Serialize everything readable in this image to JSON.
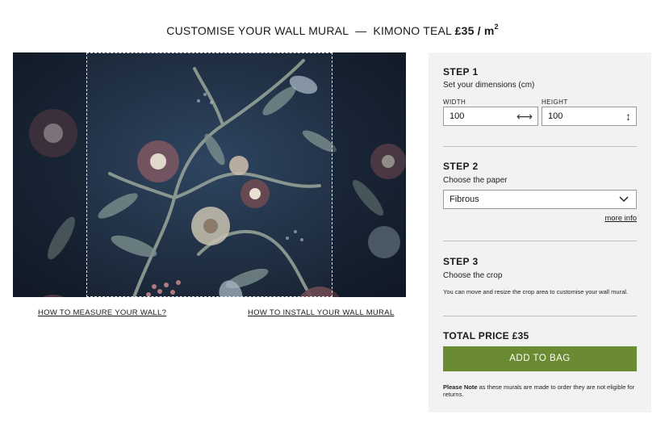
{
  "header": {
    "prefix": "CUSTOMISE YOUR WALL MURAL",
    "separator": "—",
    "product": "KIMONO TEAL",
    "price": "£35 / m",
    "unit_sup": "2"
  },
  "mural": {
    "links": {
      "measure": "HOW TO MEASURE YOUR WALL?",
      "install": "HOW TO INSTALL YOUR WALL MURAL"
    }
  },
  "panel": {
    "step1": {
      "title": "STEP 1",
      "subtitle": "Set your dimensions (cm)",
      "width_label": "WIDTH",
      "width_value": "100",
      "height_label": "HEIGHT",
      "height_value": "100"
    },
    "step2": {
      "title": "STEP 2",
      "subtitle": "Choose the paper",
      "paper_selected": "Fibrous",
      "more_info": "more info"
    },
    "step3": {
      "title": "STEP 3",
      "subtitle": "Choose the crop",
      "description": "You can move and resize the crop area to customise your wall mural."
    },
    "total_price": "TOTAL PRICE £35",
    "add_to_bag": "ADD TO BAG",
    "note_bold": "Please Note",
    "note_text": " as these murals are made to order they are not eligible for returns."
  },
  "colors": {
    "accent_button": "#6a8b31",
    "panel_bg": "#f2f2f2",
    "mural_base": "#1d2c3f"
  }
}
